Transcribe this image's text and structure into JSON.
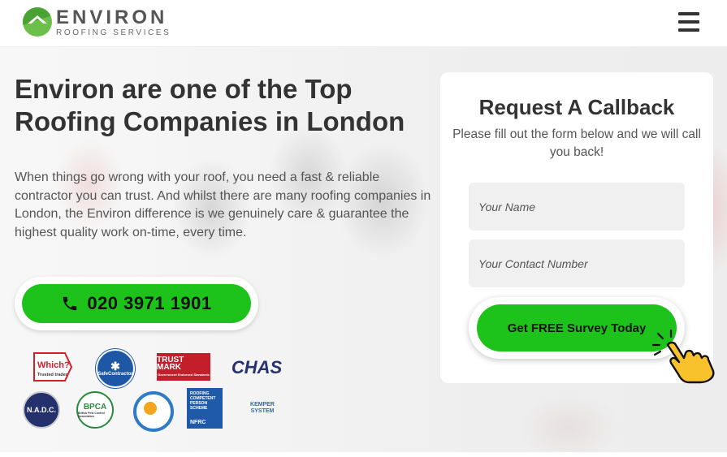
{
  "header": {
    "logo_title": "ENVIRON",
    "logo_subtitle": "ROOFING SERVICES",
    "menu_icon": "hamburger-icon"
  },
  "hero": {
    "headline": "Environ are one of the Top Roofing Companies in London",
    "intro": "When things go wrong with your roof, you need a fast & reliable contractor you can trust. And whilst there are many roofing companies in London, the Environ difference is we genuinely care & guarantee the highest quality work on-time, every time.",
    "phone_label": "020 3971 1901",
    "phone_icon": "phone-icon"
  },
  "badges": {
    "which": "Which? Trusted trader",
    "safecontractor": "SafeContractor",
    "trustmark_title": "TRUST MARK",
    "trustmark_sub": "Government Endorsed Standards",
    "chas": "CHAS",
    "nadc": "N.A.D.C.",
    "bpca": "BPCA",
    "bpca_sub": "British Pest Control Association",
    "rcp": "ROOFING COMPETENT PERSON SCHEME",
    "nfrc": "NFRC",
    "kemper": "KEMPER",
    "kemper_sub": "SYSTEM"
  },
  "form": {
    "title": "Request A Callback",
    "subtitle": "Please fill out the form below and we will call you back!",
    "name_placeholder": "Your Name",
    "phone_placeholder": "Your Contact Number",
    "submit_label": "Get FREE Survey Today",
    "pointer_icon": "pointing-hand-icon"
  },
  "colors": {
    "accent_green": "#1dc21a",
    "text_dark": "#333333"
  }
}
